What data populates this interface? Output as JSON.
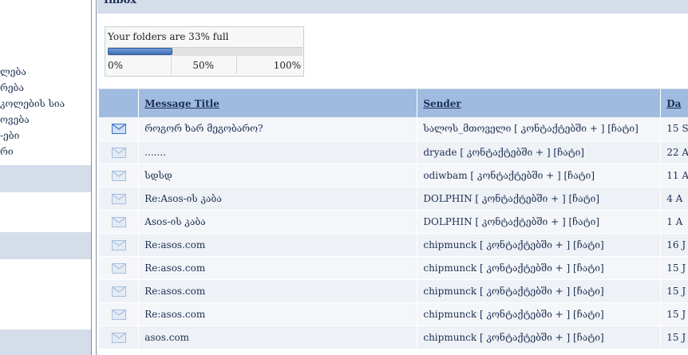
{
  "sidebar": {
    "links": [
      "ლება",
      "რება",
      "კოლების სია",
      "ოვება",
      "-ები",
      "რი"
    ]
  },
  "inbox": {
    "title": "Inbox",
    "quota_text": "Your folders are 33% full",
    "quota_percent": 33,
    "scale": [
      "0%",
      "50%",
      "100%"
    ]
  },
  "table": {
    "headers": {
      "title": "Message Title",
      "sender": "Sender",
      "date": "Da"
    },
    "rows": [
      {
        "unread": true,
        "title": "როგორ ხარ მეგობარო?",
        "sender": "სალოს_მთოველი",
        "contacts": "[ კონტაქტებში + ]",
        "chat": "[ჩატი]",
        "date": "15 S"
      },
      {
        "unread": false,
        "title": ".......",
        "sender": "dryade",
        "contacts": "[ კონტაქტებში + ]",
        "chat": "[ჩატი]",
        "date": "22 A"
      },
      {
        "unread": false,
        "title": "სდსდ",
        "sender": "odiwbam",
        "contacts": "[ კონტაქტებში + ]",
        "chat": "[ჩატი]",
        "date": "11 A"
      },
      {
        "unread": false,
        "title": "Re:Asos-ის კაბა",
        "sender": "DOLPHIN",
        "contacts": "[ კონტაქტებში + ]",
        "chat": "[ჩატი]",
        "date": "4 A"
      },
      {
        "unread": false,
        "title": "Asos-ის კაბა",
        "sender": "DOLPHIN",
        "contacts": "[ კონტაქტებში + ]",
        "chat": "[ჩატი]",
        "date": "1 A"
      },
      {
        "unread": false,
        "title": "Re:asos.com",
        "sender": "chipmunck",
        "contacts": "[ კონტაქტებში + ]",
        "chat": "[ჩატი]",
        "date": "16 J"
      },
      {
        "unread": false,
        "title": "Re:asos.com",
        "sender": "chipmunck",
        "contacts": "[ კონტაქტებში + ]",
        "chat": "[ჩატი]",
        "date": "15 J"
      },
      {
        "unread": false,
        "title": "Re:asos.com",
        "sender": "chipmunck",
        "contacts": "[ კონტაქტებში + ]",
        "chat": "[ჩატი]",
        "date": "15 J"
      },
      {
        "unread": false,
        "title": "Re:asos.com",
        "sender": "chipmunck",
        "contacts": "[ კონტაქტებში + ]",
        "chat": "[ჩატი]",
        "date": "15 J"
      },
      {
        "unread": false,
        "title": "asos.com",
        "sender": "chipmunck",
        "contacts": "[ კონტაქტებში + ]",
        "chat": "[ჩატი]",
        "date": "15 J"
      }
    ]
  },
  "colors": {
    "header": "#9fbbe0",
    "band": "#d4dde9",
    "link": "#1c2f52",
    "quota_fill": "#4a7cc4"
  }
}
